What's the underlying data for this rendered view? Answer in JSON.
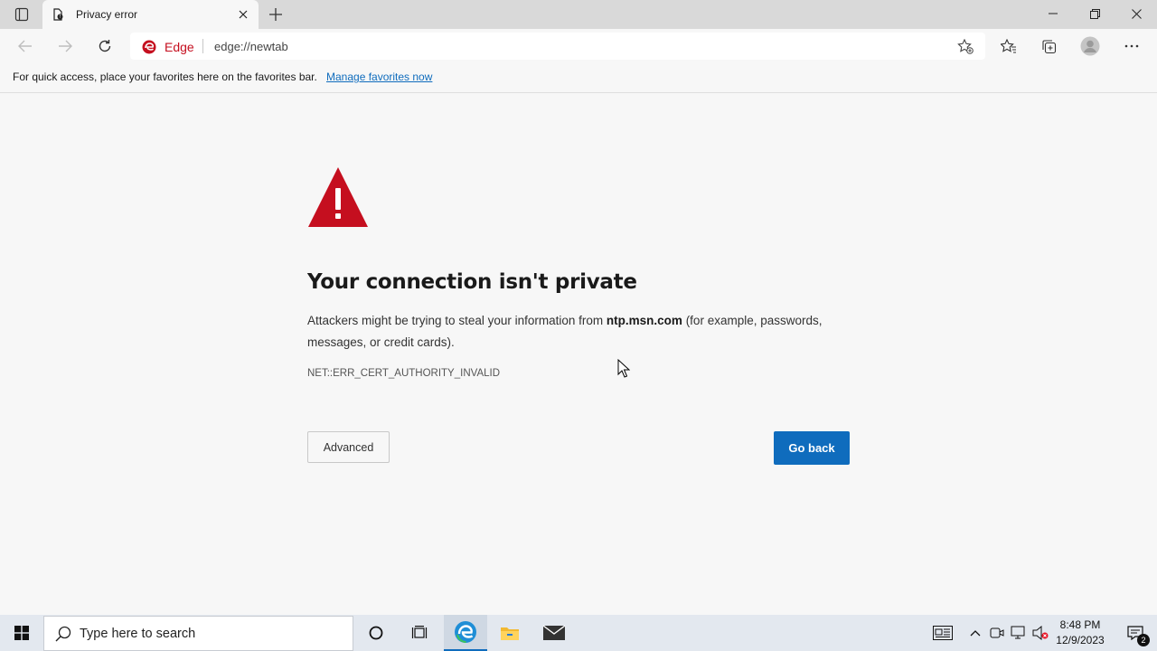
{
  "tab": {
    "title": "Privacy error"
  },
  "omnibox": {
    "site_label": "Edge",
    "url": "edge://newtab"
  },
  "favbar": {
    "message": "For quick access, place your favorites here on the favorites bar.",
    "link": "Manage favorites now"
  },
  "error": {
    "heading": "Your connection isn't private",
    "desc_before": "Attackers might be trying to steal your information from",
    "host": "ntp.msn.com",
    "desc_after": "(for example, passwords, messages, or credit cards).",
    "code": "NET::ERR_CERT_AUTHORITY_INVALID",
    "advanced_label": "Advanced",
    "back_label": "Go back"
  },
  "taskbar": {
    "search_placeholder": "Type here to search",
    "time": "8:48 PM",
    "date": "12/9/2023",
    "notification_count": "2"
  },
  "colors": {
    "accent": "#0f6cbd",
    "warning_red": "#c50f1f",
    "edge_red": "#c50f1f"
  },
  "icons": [
    "tab-actions-icon",
    "page-favicon",
    "close-icon",
    "plus-icon",
    "minimize-icon",
    "restore-icon",
    "window-close-icon",
    "back-arrow-icon",
    "forward-arrow-icon",
    "refresh-icon",
    "edge-logo-icon",
    "add-favorite-icon",
    "favorites-icon",
    "collections-icon",
    "profile-icon",
    "more-icon",
    "warning-triangle-icon",
    "cursor-icon",
    "windows-logo-icon",
    "search-icon",
    "cortana-icon",
    "task-view-icon",
    "edge-taskbar-icon",
    "file-explorer-icon",
    "mail-icon",
    "news-icon",
    "chevron-up-icon",
    "meet-now-icon",
    "network-icon",
    "volume-muted-icon",
    "notification-icon"
  ]
}
